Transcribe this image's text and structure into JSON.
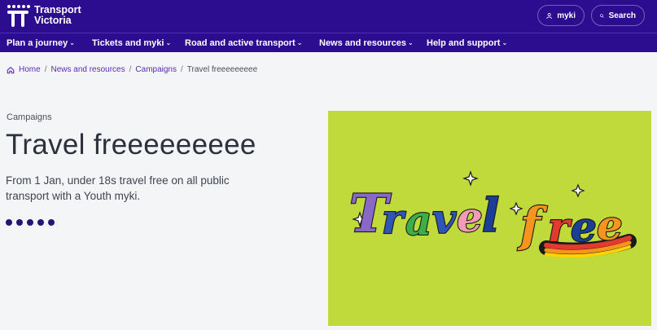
{
  "header": {
    "logo_line1": "Transport",
    "logo_line2": "Victoria",
    "myki_label": "myki",
    "search_label": "Search",
    "brand_color": "#2d0d8f"
  },
  "nav": {
    "items": [
      {
        "label": "Plan a journey"
      },
      {
        "label": "Tickets and myki"
      },
      {
        "label": "Road and active transport"
      },
      {
        "label": "News and resources"
      },
      {
        "label": "Help and support"
      }
    ]
  },
  "breadcrumb": {
    "home": "Home",
    "level1": "News and resources",
    "level2": "Campaigns",
    "current": "Travel freeeeeeeee"
  },
  "page": {
    "kicker": "Campaigns",
    "title": "Travel freeeeeeeee",
    "description": "From 1 Jan, under 18s travel free on all public transport with a Youth myki.",
    "carousel_dot_count": 5
  },
  "hero": {
    "artwork_text": "Travel free",
    "background_color": "#bfda3a"
  }
}
